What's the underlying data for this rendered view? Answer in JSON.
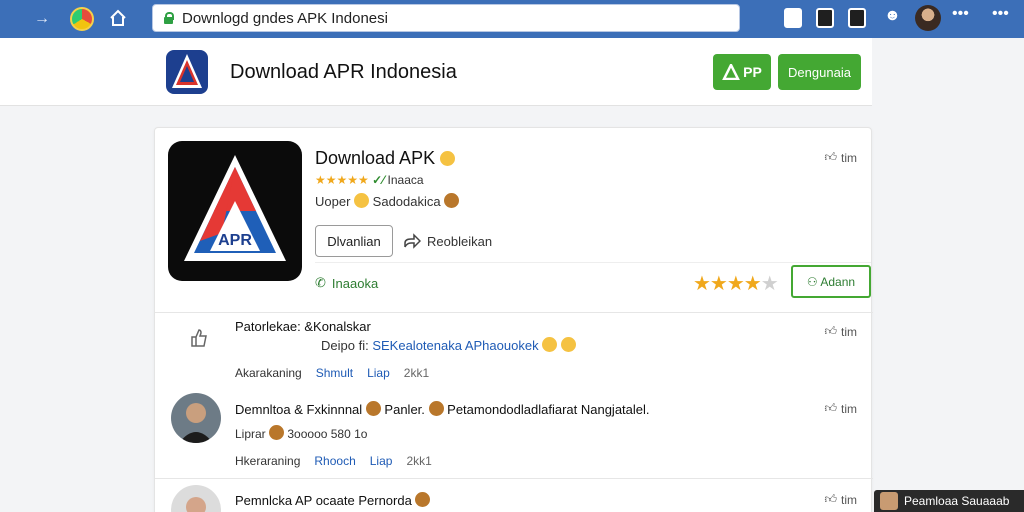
{
  "browser": {
    "url": "Downlogd gndes APK Indonesi",
    "back_icon": "arrow-right-icon",
    "home_icon": "home-icon"
  },
  "header": {
    "title": "Download APR Indonesia",
    "app_button": "PP",
    "main_button": "Dengunaia"
  },
  "app": {
    "name": "Download APK",
    "stars": "★★★★★",
    "rating_text": "Inaaca",
    "developer_prefix": "Uoper",
    "developer": "Sadodakica",
    "download_button": "Dlvanlian",
    "share_label": "Reobleikan",
    "phone_label": "Inaaoka",
    "install_button": "Adann",
    "like_label": "tim",
    "icon_text": "APR"
  },
  "rows": [
    {
      "title": "Patorlekae: &Konalskar",
      "sub_prefix": "Deipo fi:",
      "sub_link": "SEKealotenaka APhaouokek",
      "meta_a": "Akarakaning",
      "meta_b": "Shmult",
      "meta_c": "Liap",
      "meta_d": "2kk1",
      "like": "tim"
    },
    {
      "title": "Demnltoa & Fxkinnnal",
      "title_rest": "Panler.",
      "title_tail": "Petamondodladlafiarat Nangjatalel.",
      "sub_prefix": "Liprar",
      "sub": "3ooooo 580 1o",
      "meta_a": "Hkeraraning",
      "meta_b": "Rhooch",
      "meta_c": "Liap",
      "meta_d": "2kk1",
      "like": "tim"
    },
    {
      "title": "Pemnlcka AP ocaate Pernorda",
      "like": "tim"
    }
  ],
  "toast": {
    "text": "Peamloaa Sauaaab"
  },
  "colors": {
    "chrome": "#3c6fb8",
    "accent_green": "#44a833",
    "star": "#f0a81c",
    "link": "#1f5bb5"
  }
}
